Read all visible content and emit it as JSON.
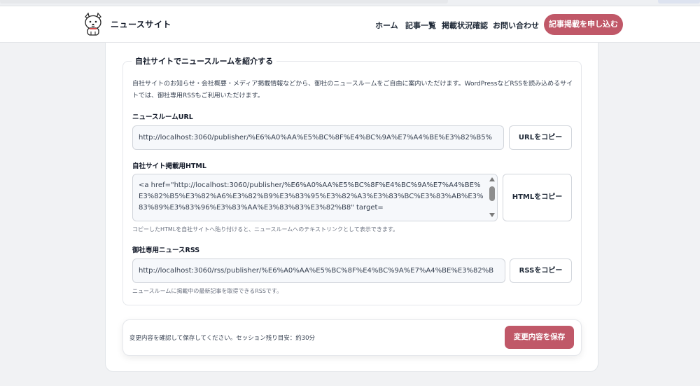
{
  "header": {
    "site_name": "ニュースサイト",
    "nav": [
      "ホーム",
      "記事一覧",
      "掲載状況確認",
      "お問い合わせ"
    ],
    "cta_label": "記事掲載を申し込む"
  },
  "newsroom_section": {
    "title": "自社サイトでニュースルームを紹介する",
    "description": "自社サイトのお知らせ・会社概要・メディア掲載情報などから、御社のニュースルームをご自由に案内いただけます。WordPressなどRSSを読み込めるサイトでは、御社専用RSSもご利用いただけます。",
    "url_label": "ニュースルームURL",
    "url_value": "http://localhost:3060/publisher/%E6%A0%AA%E5%BC%8F%E4%BC%9A%E7%A4%BE%E3%82%B5%",
    "url_copy_label": "URLをコピー",
    "html_label": "自社サイト掲載用HTML",
    "html_value": "<a href=\"http://localhost:3060/publisher/%E6%A0%AA%E5%BC%8F%E4%BC%9A%E7%A4%BE%E3%82%B5%E3%82%A6%E3%82%B9%E3%83%95%E3%82%A3%E3%83%BC%E3%83%AB%E3%83%89%E3%83%96%E3%83%AA%E3%83%83%E3%82%B8\" target=",
    "html_copy_label": "HTMLをコピー",
    "html_hint": "コピーしたHTMLを自社サイトへ貼り付けると、ニュースルームへのテキストリンクとして表示できます。",
    "rss_label": "御社専用ニュースRSS",
    "rss_value": "http://localhost:3060/rss/publisher/%E6%A0%AA%E5%BC%8F%E4%BC%9A%E7%A4%BE%E3%82%B",
    "rss_copy_label": "RSSをコピー",
    "rss_hint": "ニュースルームに掲載中の最新記事を取得できるRSSです。"
  },
  "footer": {
    "notice": "変更内容を確認して保存してください。セッション残り目安：約30分",
    "save_label": "変更内容を保存"
  },
  "colors": {
    "accent": "#c05868",
    "background": "#f1f2f4",
    "card": "#ffffff",
    "input_bg": "#f6f8fb"
  },
  "icons": {
    "logo": "dog-mascot-icon"
  }
}
